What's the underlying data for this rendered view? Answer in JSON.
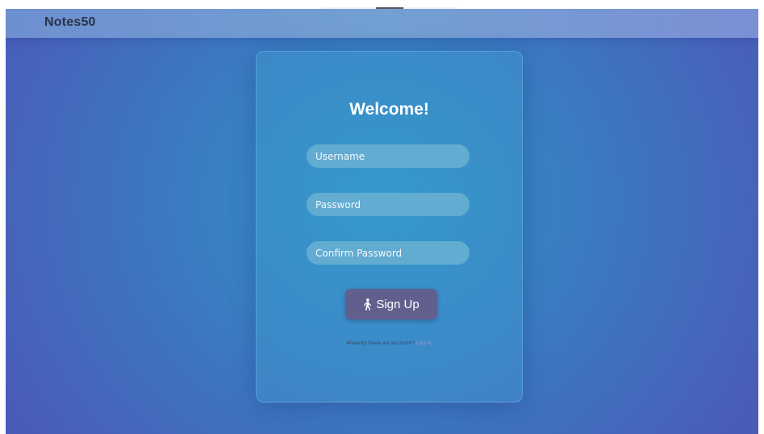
{
  "navbar": {
    "brand": "Notes50"
  },
  "form": {
    "title": "Welcome!",
    "username_placeholder": "Username",
    "password_placeholder": "Password",
    "confirm_placeholder": "Confirm Password",
    "submit_label": "Sign Up",
    "submit_icon": "walking-person-icon",
    "account_prompt": "Already have an account?",
    "login_label": "Log in"
  },
  "colors": {
    "background": "#3a7cc1",
    "button": "#615f8e",
    "link": "#b88fd4"
  }
}
